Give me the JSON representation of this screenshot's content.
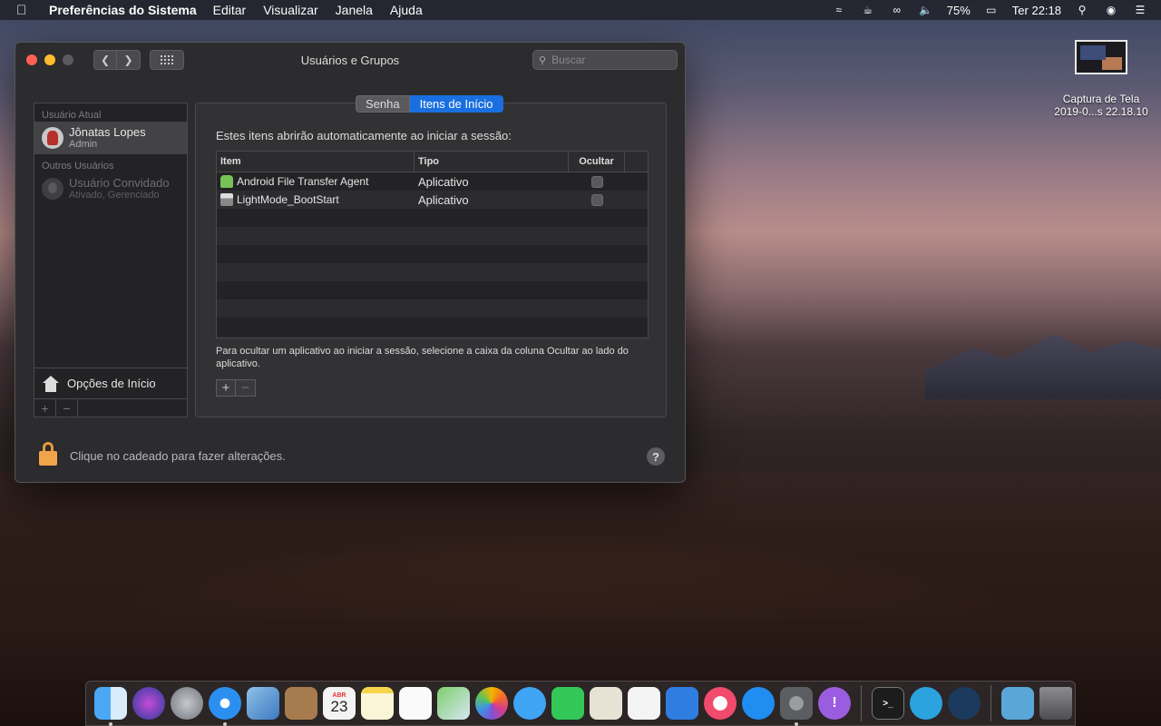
{
  "menubar": {
    "app_name": "Preferências do Sistema",
    "menus": [
      "Editar",
      "Visualizar",
      "Janela",
      "Ajuda"
    ],
    "battery": "75%",
    "clock": "Ter 22:18"
  },
  "desktop_file": {
    "name_line1": "Captura de Tela",
    "name_line2": "2019-0...s 22.18.10"
  },
  "window": {
    "title": "Usuários e Grupos",
    "search_placeholder": "Buscar",
    "sidebar": {
      "current_header": "Usuário Atual",
      "current_user": {
        "name": "Jônatas Lopes",
        "role": "Admin"
      },
      "others_header": "Outros Usuários",
      "guest_user": {
        "name": "Usuário Convidado",
        "role": "Ativado, Gerenciado"
      },
      "login_options": "Opções de Início"
    },
    "tabs": [
      "Senha",
      "Itens de Início"
    ],
    "description": "Estes itens abrirão automaticamente ao iniciar a sessão:",
    "table": {
      "headers": [
        "Item",
        "Tipo",
        "Ocultar"
      ],
      "rows": [
        {
          "item": "Android File Transfer Agent",
          "tipo": "Aplicativo"
        },
        {
          "item": "LightMode_BootStart",
          "tipo": "Aplicativo"
        }
      ]
    },
    "note": "Para ocultar um aplicativo ao iniciar a sessão, selecione a caixa da coluna Ocultar ao lado do aplicativo.",
    "lock_text": "Clique no cadeado para fazer alterações.",
    "help": "?"
  },
  "dock": {
    "calendar_month": "ABR",
    "calendar_day": "23"
  },
  "colors": {
    "accent": "#1a6fe0",
    "close": "#fe5f57",
    "minimize": "#febc2e"
  }
}
